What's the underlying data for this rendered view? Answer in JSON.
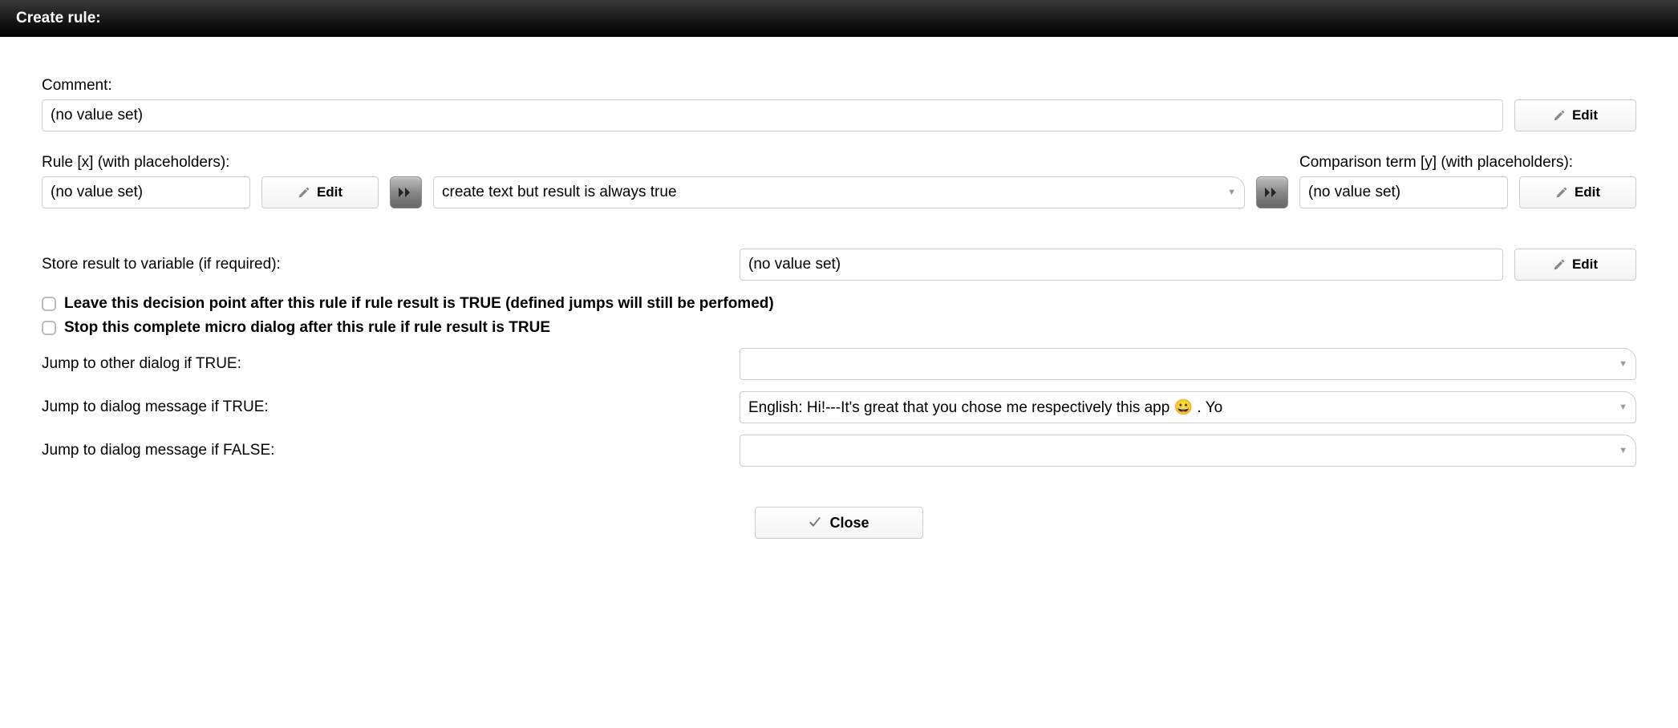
{
  "header": {
    "title": "Create rule:"
  },
  "comment": {
    "label": "Comment:",
    "value": "(no value set)",
    "edit_label": "Edit"
  },
  "rule": {
    "label": "Rule [x] (with placeholders):",
    "value": "(no value set)",
    "edit_label": "Edit"
  },
  "operator": {
    "value": "create text but result is always true"
  },
  "comparison": {
    "label": "Comparison term [y] (with placeholders):",
    "value": "(no value set)",
    "edit_label": "Edit"
  },
  "store": {
    "label": "Store result to variable (if required):",
    "value": "(no value set)",
    "edit_label": "Edit"
  },
  "checkboxes": {
    "leave": "Leave this decision point after this rule if rule result is TRUE (defined jumps will still be perfomed)",
    "stop": "Stop this complete micro dialog after this rule if rule result is TRUE"
  },
  "jumps": {
    "other_dialog_label": "Jump to other dialog if TRUE:",
    "other_dialog_value": "",
    "msg_true_label": "Jump to dialog message if TRUE:",
    "msg_true_value": "English: Hi!---It's great that you chose me respectively this app 😀 . Yo",
    "msg_false_label": "Jump to dialog message if FALSE:",
    "msg_false_value": ""
  },
  "footer": {
    "close_label": "Close"
  }
}
